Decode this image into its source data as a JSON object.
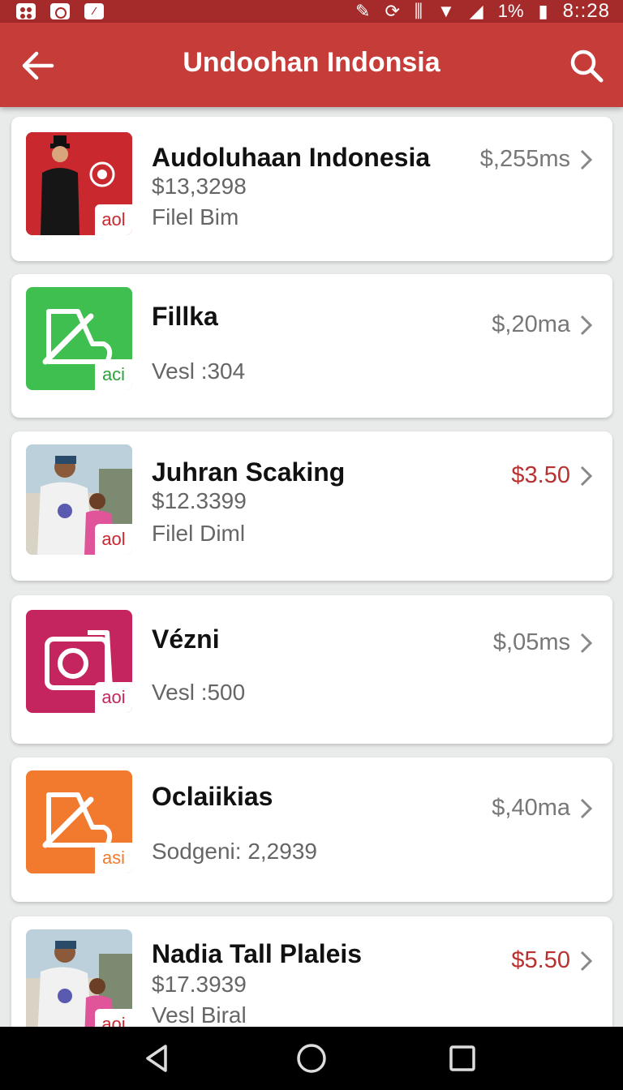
{
  "status_bar": {
    "battery": "1%",
    "time": "8::28"
  },
  "app_bar": {
    "title": "Undoohan Indonsia"
  },
  "items": [
    {
      "title": "Audoluhaan Indonesia",
      "line1": "$13,3298",
      "line2": "Filel Bim",
      "price": "$,255ms",
      "badge": "aol",
      "icon": "person-photo",
      "accent": "#c8282e"
    },
    {
      "title": "Fillka",
      "line1": "",
      "line2": "Vesl :304",
      "price": "$,20ma",
      "badge": "aci",
      "icon": "sketch-app-icon",
      "accent": "#3fbf4f"
    },
    {
      "title": "Juhran Scaking",
      "line1": "$12.3399",
      "line2": "Filel Diml",
      "price": "$3.50",
      "badge": "aol",
      "icon": "people-photo",
      "accent": "#b83232"
    },
    {
      "title": "Vézni",
      "line1": "",
      "line2": "Vesl :500",
      "price": "$,05ms",
      "badge": "aoi",
      "icon": "camera-app-icon",
      "accent": "#c5255f"
    },
    {
      "title": "Oclaiikias",
      "line1": "",
      "line2": "Sodgeni: 2,2939",
      "price": "$,40ma",
      "badge": "asi",
      "icon": "sketch-app-icon",
      "accent": "#f27a2e"
    },
    {
      "title": "Nadia Tall Plaleis",
      "line1": "$17.3939",
      "line2": "Vesl Biral",
      "price": "$5.50",
      "badge": "aoi",
      "icon": "people-photo",
      "accent": "#b83232"
    }
  ],
  "colors": {
    "app_bar": "#c63c38",
    "status_bar": "#a52a2a",
    "price_highlight": "#b83232"
  }
}
